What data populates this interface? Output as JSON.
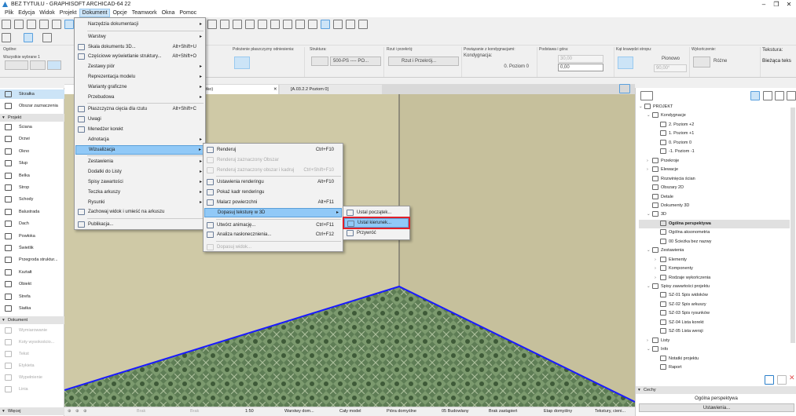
{
  "window": {
    "title": "BEZ TYTUŁU - GRAPHISOFT ARCHICAD-64 22",
    "minimize": "–",
    "maximize": "❐",
    "close": "✕"
  },
  "menubar": [
    "Plik",
    "Edycja",
    "Widok",
    "Projekt",
    "Dokument",
    "Opcje",
    "Teamwork",
    "Okna",
    "Pomoc"
  ],
  "infobox": {
    "general_label": "Ogólne:",
    "selected_label": "Wszystkie wybrane 1",
    "ref_plane_label": "Położenie płaszczyzny odniesienia:",
    "structure_label": "Struktura:",
    "structure_value": "500-PS ---- PO...",
    "floorplan_label": "Rzut i przekrój:",
    "floorplan_value": "Rzut i Przekrój...",
    "story_link_label": "Powiązanie z kondygnacjami:",
    "story_label": "Kondygnacja:",
    "story_value": "0. Poziom 0",
    "base_top_label": "Podstawa i góra:",
    "top_value": "30,00",
    "base_value": "0,00",
    "edge_angle_label": "Kąt krawędzi stropu:",
    "edge_mode": "Pionowo",
    "edge_angle": "90,00°",
    "finish_label": "Wykończenie:",
    "finish_value": "Różne",
    "texture_label": "Tekstura:",
    "texture_value": "Bieżąca teks"
  },
  "tabs": [
    {
      "label": "tko)",
      "close": "✕"
    },
    {
      "label": "[A.03.2.2 Poziom 0]"
    }
  ],
  "toolbox": {
    "top": [
      {
        "label": "Strzałka",
        "selected": true
      },
      {
        "label": "Obszar zaznaczenia"
      }
    ],
    "project_header": "Projekt",
    "project": [
      "Ściana",
      "Drzwi",
      "Okno",
      "Słup",
      "Belka",
      "Strop",
      "Schody",
      "Balustrada",
      "Dach",
      "Powłoka",
      "Świetlik",
      "Przegroda struktur...",
      "Kształt",
      "Obiekt",
      "Strefa",
      "Siatka"
    ],
    "document_header": "Dokument",
    "document": [
      "Wymiarowanie",
      "Koty wysokościo...",
      "Tekst",
      "Etykieta",
      "Wypełnienie",
      "Linia"
    ],
    "more": "Więcej"
  },
  "navigator": {
    "items": [
      {
        "label": "PROJEKT",
        "level": 0,
        "arrow": "v"
      },
      {
        "label": "Kondygnacje",
        "level": 1,
        "arrow": "v"
      },
      {
        "label": "2. Poziom +2",
        "level": 2
      },
      {
        "label": "1. Poziom +1",
        "level": 2
      },
      {
        "label": "0. Poziom 0",
        "level": 2
      },
      {
        "label": "-1. Poziom -1",
        "level": 2
      },
      {
        "label": "Przekroje",
        "level": 1,
        "arrow": ">"
      },
      {
        "label": "Elewacje",
        "level": 1,
        "arrow": ">"
      },
      {
        "label": "Rozwinięcia ścian",
        "level": 1
      },
      {
        "label": "Obszary 2D",
        "level": 1
      },
      {
        "label": "Detale",
        "level": 1
      },
      {
        "label": "Dokumenty 3D",
        "level": 1
      },
      {
        "label": "3D",
        "level": 1,
        "arrow": "v"
      },
      {
        "label": "Ogólna perspektywa",
        "level": 2,
        "selected": true
      },
      {
        "label": "Ogólna aksonometria",
        "level": 2
      },
      {
        "label": "00 Ścieżka bez nazwy",
        "level": 2
      },
      {
        "label": "Zestawienia",
        "level": 1,
        "arrow": "v"
      },
      {
        "label": "Elementy",
        "level": 2,
        "arrow": ">"
      },
      {
        "label": "Komponenty",
        "level": 2,
        "arrow": ">"
      },
      {
        "label": "Rodzaje wykończenia",
        "level": 2,
        "arrow": ">"
      },
      {
        "label": "Spisy zawartości projektu",
        "level": 1,
        "arrow": "v"
      },
      {
        "label": "SZ-01 Spis widoków",
        "level": 2
      },
      {
        "label": "SZ-02 Spis arkuszy",
        "level": 2
      },
      {
        "label": "SZ-03 Spis rysunków",
        "level": 2
      },
      {
        "label": "SZ-04 Lista korekt",
        "level": 2
      },
      {
        "label": "SZ-05 Lista wersji",
        "level": 2
      },
      {
        "label": "Listy",
        "level": 1,
        "arrow": ">"
      },
      {
        "label": "Info",
        "level": 1,
        "arrow": "v"
      },
      {
        "label": "Notatki projektu",
        "level": 2
      },
      {
        "label": "Raport",
        "level": 2
      }
    ],
    "props_header": "Cechy",
    "props_name": "Ogólna perspektywa",
    "settings_button": "Ustawienia..."
  },
  "statusbar": [
    "Brak",
    "Brak",
    "1:50",
    "Warstwy dom...",
    "Cały model",
    "Pióra domyślne",
    "05 Budowlany",
    "Brak zastąpień",
    "Etap domyślny",
    "Tekstury, cieni..."
  ],
  "dokument_menu": [
    {
      "label": "Narzędzia dokumentacji",
      "sub": true
    },
    {
      "sep": true
    },
    {
      "label": "Warstwy",
      "sub": true
    },
    {
      "label": "Skala dokumentu 3D...",
      "shortcut": "Alt+Shift+U",
      "icon": true
    },
    {
      "label": "Częściowe wyświetlanie struktury...",
      "shortcut": "Alt+Shift+O",
      "icon": true
    },
    {
      "label": "Zestawy piór",
      "sub": true
    },
    {
      "label": "Reprezentacja modelu",
      "sub": true
    },
    {
      "label": "Warianty graficzne",
      "sub": true
    },
    {
      "label": "Przebudowa",
      "sub": true
    },
    {
      "sep": true
    },
    {
      "label": "Płaszczyzna cięcia dla rzutu",
      "shortcut": "Alt+Shift+C",
      "icon": true
    },
    {
      "label": "Uwagi",
      "icon": true
    },
    {
      "label": "Menedżer korekt",
      "icon": true
    },
    {
      "label": "Adnotacja",
      "sub": true
    },
    {
      "label": "Wizualizacja",
      "sub": true,
      "highlight": true
    },
    {
      "sep": true
    },
    {
      "label": "Zestawienia",
      "sub": true
    },
    {
      "label": "Dodatki do Listy",
      "sub": true
    },
    {
      "label": "Spisy zawartości",
      "sub": true
    },
    {
      "label": "Teczka arkuszy",
      "sub": true
    },
    {
      "label": "Rysunki",
      "sub": true
    },
    {
      "label": "Zachowaj widok i umieść na arkuszu",
      "icon": true
    },
    {
      "sep": true
    },
    {
      "label": "Publikacja...",
      "icon": true
    }
  ],
  "wizualizacja_menu": [
    {
      "label": "Renderuj",
      "shortcut": "Ctrl+F10",
      "icon": true
    },
    {
      "label": "Renderuj zaznaczony Obszar",
      "icon": true,
      "disabled": true
    },
    {
      "label": "Renderuj zaznaczony obszar i kadruj",
      "shortcut": "Ctrl+Shift+F10",
      "icon": true,
      "disabled": true
    },
    {
      "sep": true
    },
    {
      "label": "Ustawienia renderingu",
      "shortcut": "Alt+F10",
      "icon": true
    },
    {
      "label": "Pokaż kadr renderingu",
      "icon": true
    },
    {
      "label": "Malarz powierzchni",
      "shortcut": "Alt+F11",
      "icon": true
    },
    {
      "label": "Dopasuj teksturę w 3D",
      "sub": true,
      "highlight": true
    },
    {
      "sep": true
    },
    {
      "label": "Utwórz animację...",
      "shortcut": "Ctrl+F11",
      "icon": true
    },
    {
      "label": "Analiza nasłonecznienia...",
      "shortcut": "Ctrl+F12",
      "icon": true
    },
    {
      "sep": true
    },
    {
      "label": "Dopasuj widok...",
      "icon": true,
      "disabled": true
    }
  ],
  "texture_menu": [
    {
      "label": "Ustal początek...",
      "icon": true
    },
    {
      "label": "Ustal kierunek...",
      "icon": true,
      "highlight": true,
      "boxed": true
    },
    {
      "label": "Przywróć",
      "icon": true
    }
  ],
  "colors": {
    "highlight": "#91c9f7",
    "selection_box": "#e0202a",
    "wall_left": "#cfc9a6",
    "wall_right": "#c6c09c",
    "floor": "#5e7d55",
    "floor_edge": "#1a1aff"
  }
}
